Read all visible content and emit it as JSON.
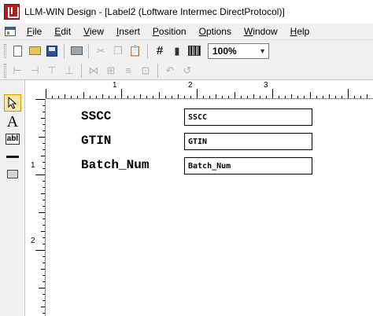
{
  "window": {
    "title": "LLM-WIN Design - [Label2 (Loftware Intermec DirectProtocol)]"
  },
  "menu": [
    {
      "label": "File",
      "key": "F",
      "rest": "ile"
    },
    {
      "label": "Edit",
      "key": "E",
      "rest": "dit"
    },
    {
      "label": "View",
      "key": "V",
      "rest": "iew"
    },
    {
      "label": "Insert",
      "key": "I",
      "rest": "nsert"
    },
    {
      "label": "Position",
      "key": "P",
      "rest": "osition"
    },
    {
      "label": "Options",
      "key": "O",
      "rest": "ptions"
    },
    {
      "label": "Window",
      "key": "W",
      "rest": "indow"
    },
    {
      "label": "Help",
      "key": "H",
      "rest": "elp"
    }
  ],
  "toolbar": {
    "zoom_value": "100%",
    "icons": [
      "new-icon",
      "open-icon",
      "save-icon",
      "print-icon",
      "cut-icon",
      "copy-icon",
      "paste-icon",
      "grid-icon",
      "device-icon",
      "barcode-icon"
    ]
  },
  "ruler": {
    "top_numbers": [
      "1",
      "2",
      "3"
    ],
    "left_numbers": [
      "1",
      "2"
    ]
  },
  "label": {
    "fields": [
      {
        "name": "SSCC",
        "value": "SSCC"
      },
      {
        "name": "GTIN",
        "value": "GTIN"
      },
      {
        "name": "Batch_Num",
        "value": "Batch_Num"
      }
    ]
  },
  "colors": {
    "chrome": "#f0f0f0",
    "selection": "#fde7a7",
    "app_icon": "#b01e1e"
  }
}
